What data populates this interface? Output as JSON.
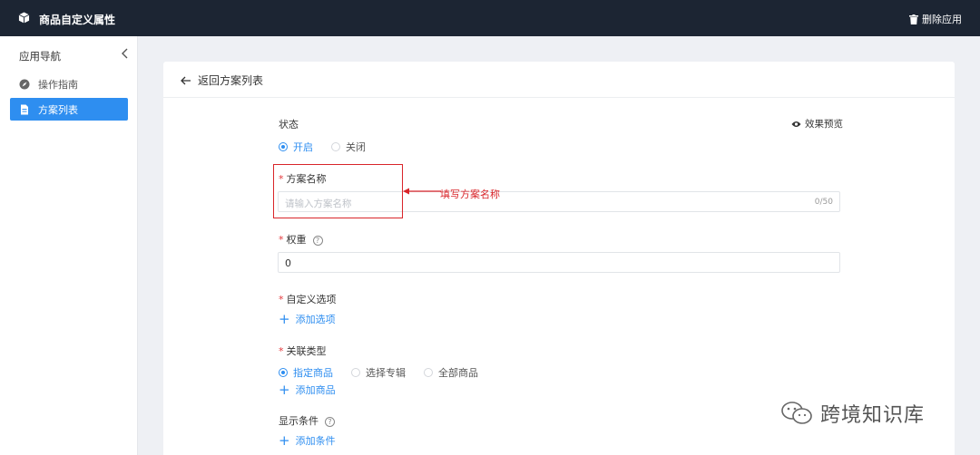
{
  "app": {
    "title": "商品自定义属性",
    "delete_label": "删除应用"
  },
  "sidebar": {
    "title": "应用导航",
    "items": [
      {
        "label": "操作指南",
        "icon": "compass-icon",
        "active": false
      },
      {
        "label": "方案列表",
        "icon": "document-icon",
        "active": true
      }
    ]
  },
  "page": {
    "back_label": "返回方案列表",
    "preview_label": "效果预览"
  },
  "form": {
    "status": {
      "label": "状态",
      "options": [
        "开启",
        "关闭"
      ],
      "selected": "开启"
    },
    "name": {
      "required_mark": "*",
      "label": "方案名称",
      "placeholder": "请输入方案名称",
      "counter": "0/50"
    },
    "weight": {
      "required_mark": "*",
      "label": "权重",
      "help": "?",
      "value": "0"
    },
    "custom_options": {
      "required_mark": "*",
      "label": "自定义选项",
      "add_label": "添加选项"
    },
    "link_type": {
      "required_mark": "*",
      "label": "关联类型",
      "options": [
        "指定商品",
        "选择专辑",
        "全部商品"
      ],
      "selected": "指定商品",
      "add_label": "添加商品"
    },
    "display_condition": {
      "label": "显示条件",
      "help": "?",
      "add_label": "添加条件"
    }
  },
  "annotation": {
    "text": "填写方案名称",
    "color": "#d9252a"
  },
  "watermark": {
    "text": "跨境知识库"
  },
  "colors": {
    "topbar": "#1c2533",
    "accent": "#2e8ef0",
    "background": "#eef0f4"
  }
}
